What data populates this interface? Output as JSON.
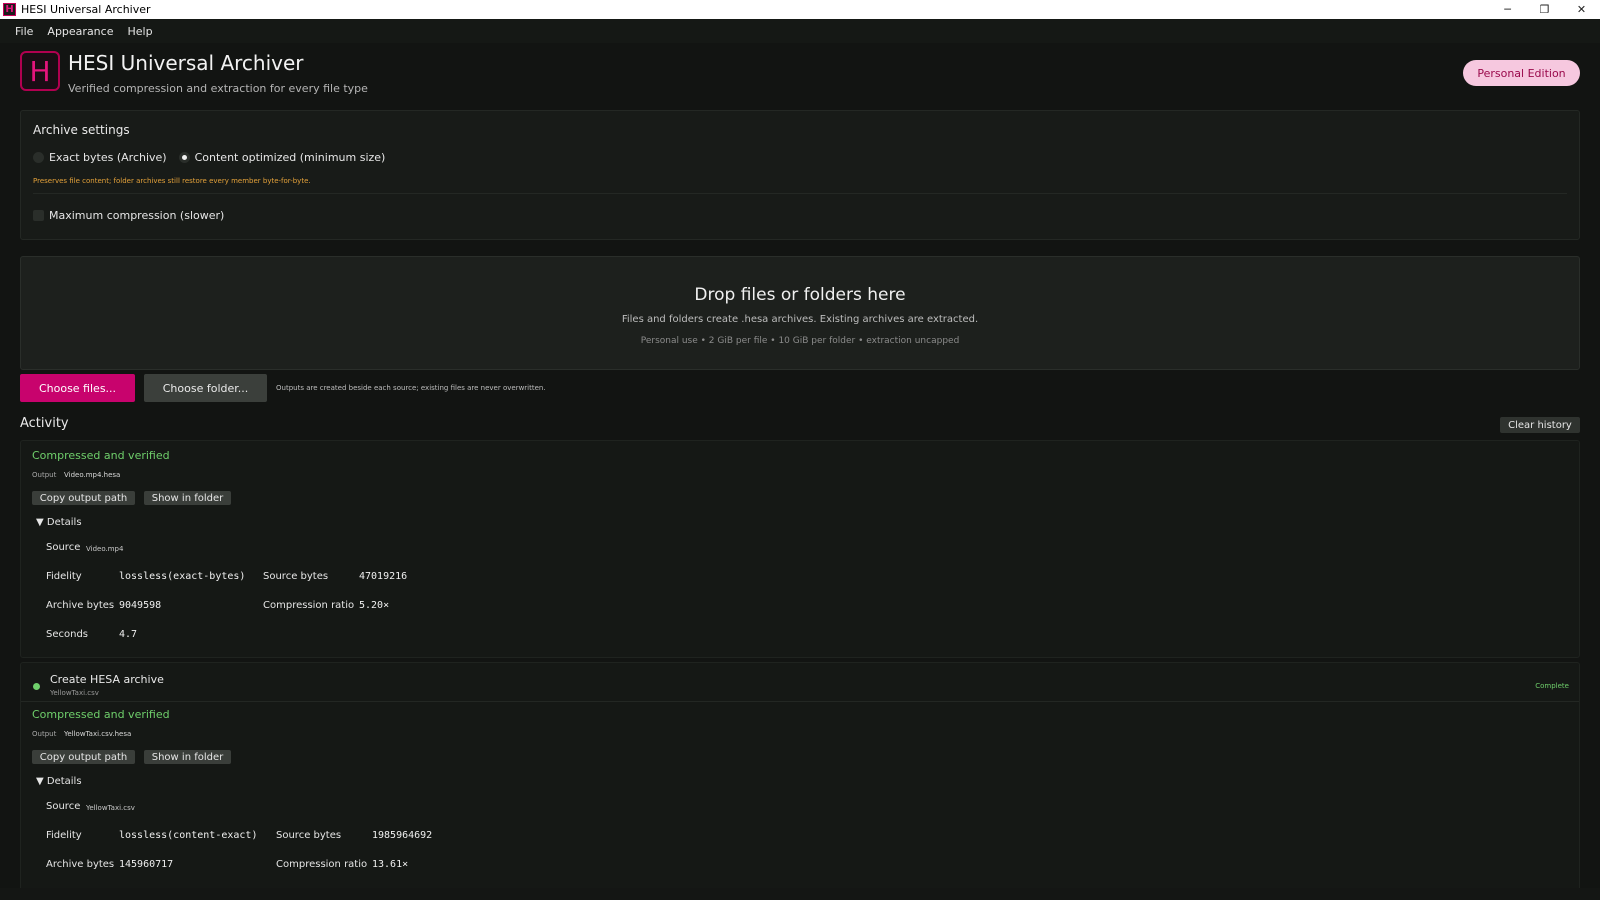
{
  "window": {
    "title": "HESI Universal Archiver",
    "icon_letter": "H",
    "controls": {
      "minimize": "─",
      "restore": "❐",
      "close": "✕"
    }
  },
  "menu": [
    "File",
    "Appearance",
    "Help"
  ],
  "header": {
    "logo_letter": "H",
    "title": "HESI Universal Archiver",
    "subtitle": "Verified compression and extraction for every file type",
    "edition": "Personal Edition"
  },
  "settings": {
    "title": "Archive settings",
    "mode_options": [
      {
        "label": "Exact bytes (Archive)",
        "selected": false
      },
      {
        "label": "Content optimized (minimum size)",
        "selected": true
      }
    ],
    "note": "Preserves file content; folder archives still restore every member byte-for-byte.",
    "max_compression_label": "Maximum compression (slower)",
    "max_compression_checked": false
  },
  "dropzone": {
    "title": "Drop files or folders here",
    "subtitle": "Files and folders create .hesa archives. Existing archives are extracted.",
    "limits": "Personal use • 2 GiB per file • 10 GiB per folder • extraction uncapped"
  },
  "actions": {
    "choose_files": "Choose files...",
    "choose_folder": "Choose folder...",
    "outputs_note": "Outputs are created beside each source; existing files are never overwritten."
  },
  "activity": {
    "title": "Activity",
    "clear_history": "Clear history",
    "entries": [
      {
        "status": "Compressed and verified",
        "output_label": "Output",
        "output_value": "Video.mp4.hesa",
        "copy_button": "Copy output path",
        "show_button": "Show in folder",
        "details_label": "▼ Details",
        "source_label": "Source",
        "source_value": "Video.mp4",
        "fidelity_label": "Fidelity",
        "fidelity_value": "lossless(exact-bytes)",
        "source_bytes_label": "Source bytes",
        "source_bytes_value": "47019216",
        "archive_bytes_label": "Archive bytes",
        "archive_bytes_value": "9049598",
        "ratio_label": "Compression ratio",
        "ratio_value": "5.20×",
        "seconds_label": "Seconds",
        "seconds_value": "4.7"
      },
      {
        "task_title": "Create HESA archive",
        "task_file": "YellowTaxi.csv",
        "task_status": "Complete",
        "status": "Compressed and verified",
        "output_label": "Output",
        "output_value": "YellowTaxi.csv.hesa",
        "copy_button": "Copy output path",
        "show_button": "Show in folder",
        "details_label": "▼ Details",
        "source_label": "Source",
        "source_value": "YellowTaxi.csv",
        "fidelity_label": "Fidelity",
        "fidelity_value": "lossless(content-exact)",
        "source_bytes_label": "Source bytes",
        "source_bytes_value": "1985964692",
        "archive_bytes_label": "Archive bytes",
        "archive_bytes_value": "145960717",
        "ratio_label": "Compression ratio",
        "ratio_value": "13.61×"
      }
    ]
  },
  "colors": {
    "accent": "#c8036d",
    "success": "#6fcf6b",
    "warning": "#e3a13a",
    "background": "#121412"
  }
}
